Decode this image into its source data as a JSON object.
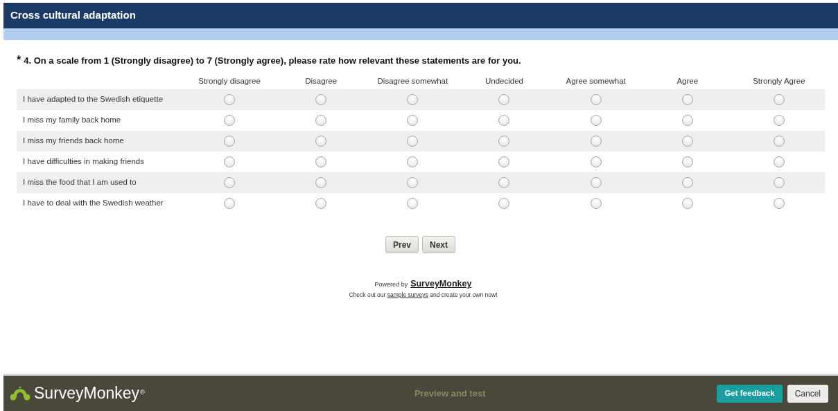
{
  "header": {
    "title": "Cross cultural adaptation"
  },
  "question": {
    "required_mark": "*",
    "text": "4. On a scale from 1 (Strongly disagree) to 7 (Strongly agree), please rate how relevant these statements are for you."
  },
  "columns": [
    "Strongly disagree",
    "Disagree",
    "Disagree somewhat",
    "Undecided",
    "Agree somewhat",
    "Agree",
    "Strongly Agree"
  ],
  "rows": [
    {
      "label": "I have adapted to the Swedish etiquette",
      "options": [
        {
          "selected": false
        },
        {
          "selected": false
        },
        {
          "selected": false
        },
        {
          "selected": false
        },
        {
          "selected": false
        },
        {
          "selected": false
        },
        {
          "selected": false
        }
      ]
    },
    {
      "label": "I miss my family back home",
      "options": [
        {
          "selected": false
        },
        {
          "selected": false
        },
        {
          "selected": false
        },
        {
          "selected": false
        },
        {
          "selected": false
        },
        {
          "selected": false
        },
        {
          "selected": false
        }
      ]
    },
    {
      "label": "I miss my friends back home",
      "options": [
        {
          "selected": false
        },
        {
          "selected": false
        },
        {
          "selected": false
        },
        {
          "selected": false
        },
        {
          "selected": false
        },
        {
          "selected": false
        },
        {
          "selected": false
        }
      ]
    },
    {
      "label": "I have difficulties in making friends",
      "options": [
        {
          "selected": false
        },
        {
          "selected": false
        },
        {
          "selected": false
        },
        {
          "selected": false
        },
        {
          "selected": false
        },
        {
          "selected": false
        },
        {
          "selected": false
        }
      ]
    },
    {
      "label": "I miss the food that I am used to",
      "options": [
        {
          "selected": false
        },
        {
          "selected": false
        },
        {
          "selected": false
        },
        {
          "selected": false
        },
        {
          "selected": false
        },
        {
          "selected": false
        },
        {
          "selected": false
        }
      ]
    },
    {
      "label": "I have to deal with the Swedish weather",
      "options": [
        {
          "selected": false
        },
        {
          "selected": false
        },
        {
          "selected": false
        },
        {
          "selected": false
        },
        {
          "selected": false
        },
        {
          "selected": false
        },
        {
          "selected": false
        }
      ]
    }
  ],
  "nav_buttons": [
    "Prev",
    "Next"
  ],
  "powered": {
    "prefix": "Powered by",
    "link": "SurveyMonkey"
  },
  "promo": {
    "before": "Check out our",
    "link": "sample surveys",
    "after": "and create your own now!"
  },
  "footer_bar": {
    "brand": "SurveyMonkey",
    "registered": "®",
    "mode": "Preview and test",
    "primary_button": "Get feedback",
    "secondary_button": "Cancel"
  }
}
